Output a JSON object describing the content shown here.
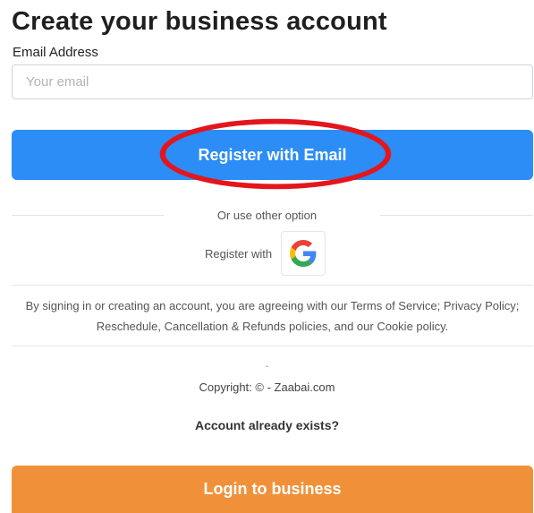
{
  "header": {
    "title": "Create your business account"
  },
  "form": {
    "email_label": "Email Address",
    "email_placeholder": "Your email",
    "email_value": "",
    "register_button_label": "Register with Email"
  },
  "alternatives": {
    "or_text": "Or use other option",
    "register_with_label": "Register with",
    "providers": [
      "google-icon"
    ]
  },
  "legal": {
    "terms_text": "By signing in or creating an account, you are agreeing with our Terms of Service; Privacy Policy; Reschedule, Cancellation & Refunds policies, and our Cookie policy."
  },
  "footer": {
    "separator_mark": ".",
    "copyright": "Copyright: © - Zaabai.com",
    "account_exists_link": "Account already exists?",
    "login_button_label": "Login to business"
  },
  "colors": {
    "primary_button": "#2b8df5",
    "login_button": "#f0913a",
    "annotation_ellipse": "#e3161d",
    "google_blue": "#4285F4",
    "google_red": "#EA4335",
    "google_yellow": "#FBBC05",
    "google_green": "#34A853"
  },
  "annotations": {
    "highlight": "red-ellipse-around-register-button"
  }
}
